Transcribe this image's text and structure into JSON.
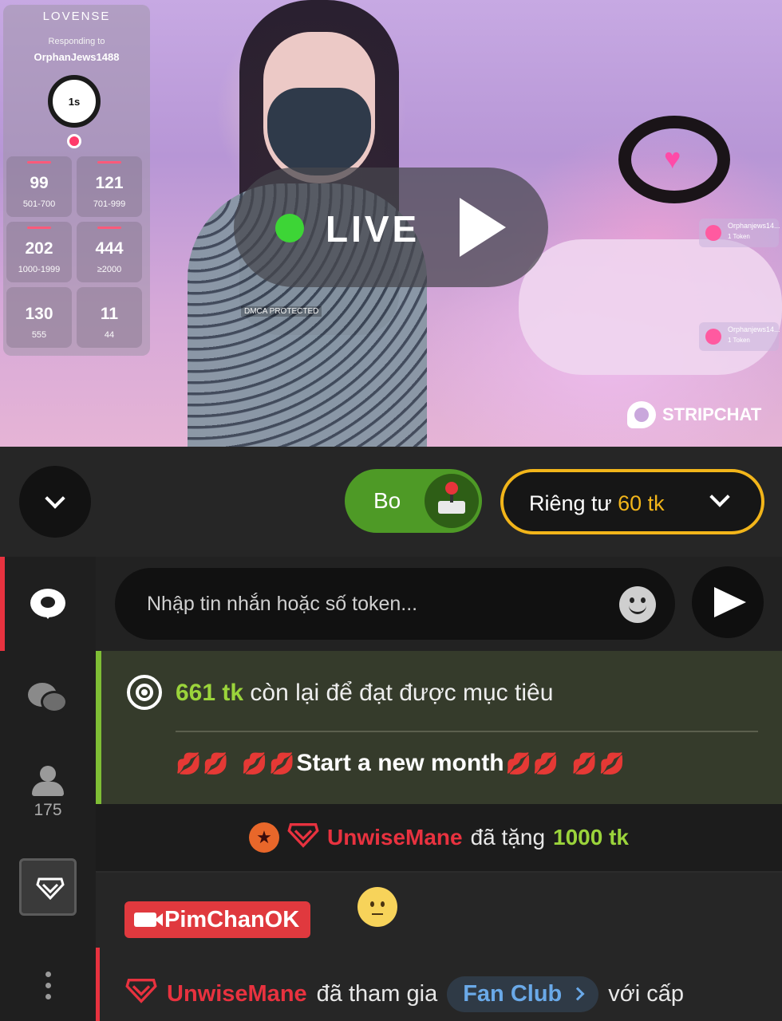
{
  "video": {
    "lovense": {
      "brand": "LOVENSE",
      "responding_to": "Responding to",
      "username": "OrphanJews1488",
      "timer": "1s",
      "levels": [
        {
          "value": "99",
          "range": "501-700"
        },
        {
          "value": "121",
          "range": "701-999"
        },
        {
          "value": "202",
          "range": "1000-1999"
        },
        {
          "value": "444",
          "range": "≥2000"
        },
        {
          "value": "130",
          "range": "555"
        },
        {
          "value": "11",
          "range": "44"
        }
      ]
    },
    "live_label": "LIVE",
    "watermark": "DMCA PROTECTED",
    "notifications": [
      {
        "name": "Orphanjews14...",
        "tokens": "1 Token"
      },
      {
        "name": "Orphanjews14...",
        "tokens": "1 Token"
      }
    ],
    "brand": "STRIPCHAT"
  },
  "controls": {
    "bo_label": "Bo",
    "private_label": "Riêng tư",
    "private_price": "60 tk"
  },
  "rail": {
    "user_count": "175"
  },
  "chat": {
    "input_placeholder": "Nhập tin nhắn hoặc số token...",
    "goal": {
      "amount": "661 tk",
      "text": "còn lại để đạt được mục tiêu",
      "description": "Start a new month"
    },
    "tip": {
      "user": "UnwiseMane",
      "verb": "đã tặng",
      "amount": "1000 tk"
    },
    "cam_user": "PimChanOK",
    "fan": {
      "user": "UnwiseMane",
      "verb": "đã tham gia",
      "club": "Fan Club",
      "suffix": "với cấp"
    }
  },
  "colors": {
    "live_dot": "#3dd536",
    "accent_red": "#e8323f",
    "token_green": "#9bd43b",
    "private_gold": "#f2b51a",
    "bo_green": "#4e9a26"
  }
}
